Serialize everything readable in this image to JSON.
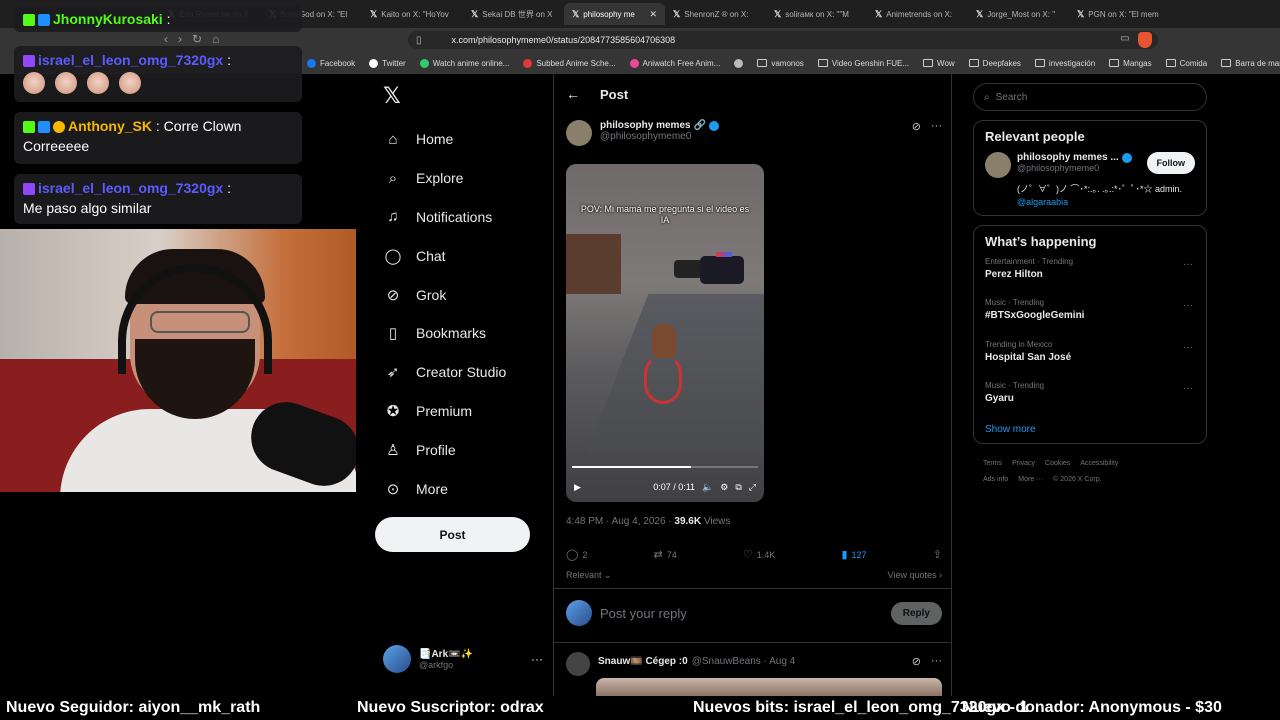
{
  "browser": {
    "tabs": [
      {
        "text": "Edu Rivera мк on X",
        "active": false
      },
      {
        "text": "BorjaGod on X: \"El",
        "active": false
      },
      {
        "text": "Kaito on X: \"HoYov",
        "active": false
      },
      {
        "text": "Sekai DB 世界 on X",
        "active": false
      },
      {
        "text": "philosophy me",
        "active": true
      },
      {
        "text": "ShenronZ ® on X:",
        "active": false
      },
      {
        "text": "soliraмк on X: \"\"M",
        "active": false
      },
      {
        "text": "Animetrends on X:",
        "active": false
      },
      {
        "text": "Jorge_Most on X: \"",
        "active": false
      },
      {
        "text": "PGN on X: \"El mem",
        "active": false
      }
    ],
    "url": "x.com/philosophymeme0/status/2084773585604706308",
    "bookmarks": [
      {
        "label": "Facebook",
        "icon": "facebook-icon",
        "color": "#1877f2"
      },
      {
        "label": "Twitter",
        "icon": "x-icon",
        "color": "#ffffff"
      },
      {
        "label": "Watch anime online...",
        "icon": "leaf-icon",
        "color": "#2ecc71"
      },
      {
        "label": "Subbed Anime Sche...",
        "icon": "red-icon",
        "color": "#e53935"
      },
      {
        "label": "Aniwatch Free Anim...",
        "icon": "aniwatch-icon",
        "color": "#ec4899"
      },
      {
        "label": "",
        "icon": "misc-icon",
        "color": "#bbbbbb"
      },
      {
        "label": "vamonos",
        "icon": "folder-icon"
      },
      {
        "label": "Video Genshin FUE...",
        "icon": "folder-icon"
      },
      {
        "label": "Wow",
        "icon": "folder-icon"
      },
      {
        "label": "Deepfakes",
        "icon": "folder-icon"
      },
      {
        "label": "investigación",
        "icon": "folder-icon"
      },
      {
        "label": "Mangas",
        "icon": "folder-icon"
      },
      {
        "label": "Comida",
        "icon": "folder-icon"
      },
      {
        "label": "Barra de marcadores",
        "icon": "folder-icon"
      }
    ]
  },
  "nav": {
    "items": [
      {
        "label": "Home",
        "icon": "⌂",
        "name": "home"
      },
      {
        "label": "Explore",
        "icon": "⌕",
        "name": "explore"
      },
      {
        "label": "Notifications",
        "icon": "♫",
        "name": "notifications"
      },
      {
        "label": "Chat",
        "icon": "◯",
        "name": "chat"
      },
      {
        "label": "Grok",
        "icon": "⊘",
        "name": "grok"
      },
      {
        "label": "Bookmarks",
        "icon": "▯",
        "name": "bookmarks"
      },
      {
        "label": "Creator Studio",
        "icon": "➶",
        "name": "creator-studio"
      },
      {
        "label": "Premium",
        "icon": "✪",
        "name": "premium"
      },
      {
        "label": "Profile",
        "icon": "♙",
        "name": "profile"
      },
      {
        "label": "More",
        "icon": "⊙",
        "name": "more"
      }
    ],
    "post_button": "Post",
    "account": {
      "name": "📑Ark📼✨",
      "handle": "@arkfgo"
    }
  },
  "post": {
    "header": "Post",
    "author_name": "philosophy memes",
    "author_handle": "@philosophymeme0",
    "video_caption": "POV: Mi mamá me pregunta si el video es IA",
    "video_time": "0:07 / 0:11",
    "video_progress": 0.64,
    "timestamp": "4:48 PM · Aug 4, 2026 · ",
    "views": "39.6K",
    "views_label": " Views",
    "stats": {
      "replies": "2",
      "reposts": "74",
      "likes": "1.4K",
      "bookmarks": "127"
    },
    "sort_label": "Relevant",
    "view_quotes": "View quotes",
    "reply_placeholder": "Post your reply",
    "reply_button": "Reply",
    "comment": {
      "name": "Snauw🎞️ Cégep :0",
      "handle": "@SnauwBeans · Aug 4"
    }
  },
  "sidebar": {
    "search_placeholder": "Search",
    "relevant_title": "Relevant people",
    "person": {
      "name": "philosophy memes ...",
      "handle": "@philosophymeme0",
      "bio": "(ノ゜∀゜)ノ ⌒･*:.｡. .｡.:*･゜ﾟ･*☆ admin.",
      "link": "@algaraabia",
      "follow": "Follow"
    },
    "happening_title": "What’s happening",
    "trends": [
      {
        "category": "Entertainment · Trending",
        "name": "Perez Hilton"
      },
      {
        "category": "Music · Trending",
        "name": "#BTSxGoogleGemini"
      },
      {
        "category": "Trending in Mexico",
        "name": "Hospital San José"
      },
      {
        "category": "Music · Trending",
        "name": "Gyaru"
      }
    ],
    "show_more": "Show more",
    "footer": [
      "Terms",
      "Privacy",
      "Cookies",
      "Accessibility",
      "Ads info",
      "More ···",
      "© 2026 X Corp."
    ]
  },
  "chat": [
    {
      "user": "JhonnyKurosaki",
      "user_color": "#53fc18",
      "text": ""
    },
    {
      "user": "israel_el_leon_omg_7320gx",
      "user_color": "#5b5bff",
      "text": ""
    },
    {
      "user": "Anthony_SK",
      "user_color": "#f5b700",
      "text": "Corre Clown Correeeee"
    },
    {
      "user": "israel_el_leon_omg_7320gx",
      "user_color": "#5b5bff",
      "text": "Me paso algo similar"
    }
  ],
  "ticker": {
    "follower": "Nuevo Seguidor: aiyon__mk_rath",
    "subscriber": "Nuevo Suscriptor: odrax",
    "bits": "Nuevos bits: israel_el_leon_omg_7320gx - 1",
    "donor": "Nuevo donador: Anonymous - $30"
  },
  "colors": {
    "accent": "#1d9bf0",
    "background": "#000000",
    "border": "#2f3336",
    "muted": "#71767b"
  }
}
